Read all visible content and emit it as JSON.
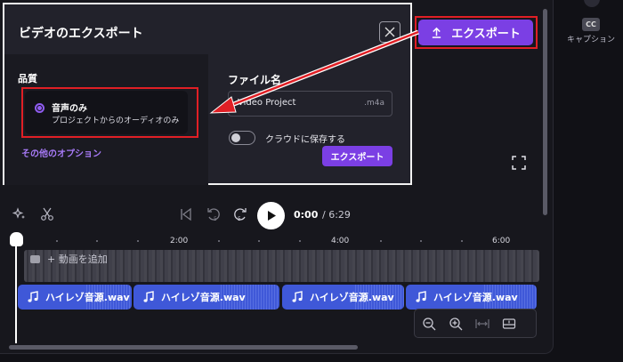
{
  "dialog": {
    "title": "ビデオのエクスポート",
    "quality_label": "品質",
    "option_title": "音声のみ",
    "option_subtitle": "プロジェクトからのオーディオのみ",
    "more_options": "その他のオプション",
    "filename_label": "ファイル名",
    "filename_value": "Video Project",
    "filename_ext": ".m4a",
    "cloud_save_label": "クラウドに保存する",
    "cloud_save_on": false,
    "export_button": "エクスポート"
  },
  "toolbar": {
    "export_button": "エクスポート",
    "time_current": "0:00",
    "time_total": "/ 6:29"
  },
  "right_panel": {
    "captions_badge": "CC",
    "captions_label": "キャプション"
  },
  "timeline": {
    "ruler": [
      "2:00",
      "4:00",
      "6:00"
    ],
    "add_video": "+ 動画を追加",
    "clips": [
      {
        "label": "ハイレゾ音源.wav"
      },
      {
        "label": "ハイレゾ音源.wav"
      },
      {
        "label": "ハイレゾ音源.wav"
      },
      {
        "label": "ハイレゾ音源.wav"
      }
    ]
  },
  "colors": {
    "accent": "#7b3fe4",
    "highlight": "#e01f25",
    "clip": "#3f58d8"
  }
}
